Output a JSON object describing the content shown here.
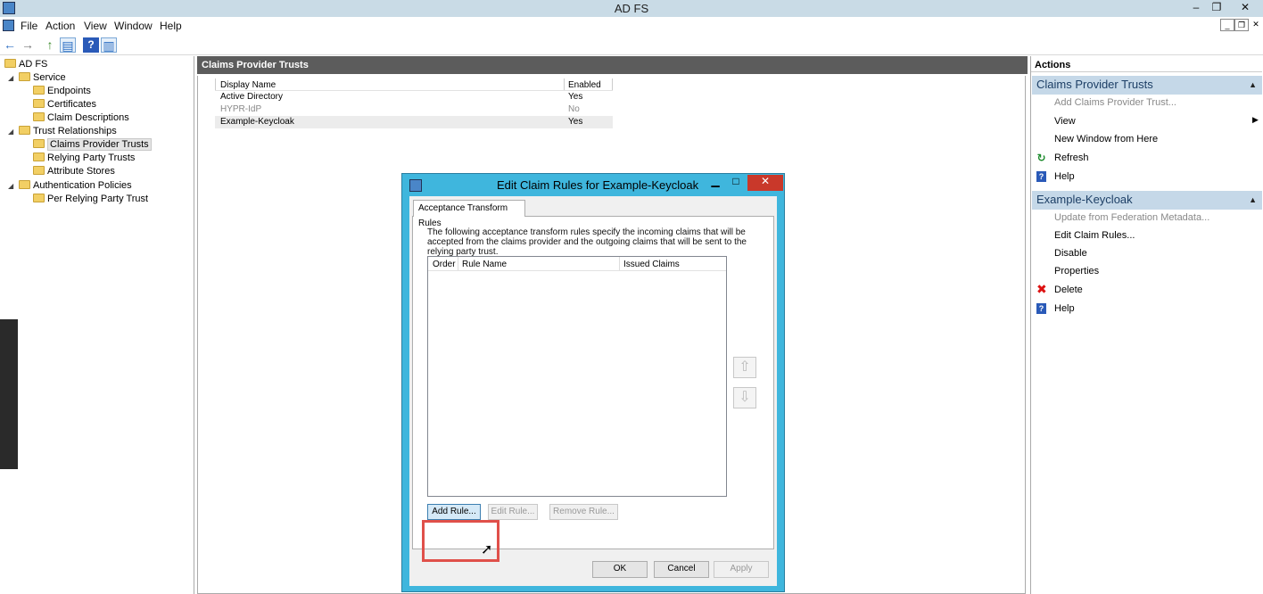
{
  "window": {
    "title": "AD FS",
    "min": "–",
    "restore": "❐",
    "close": "✕"
  },
  "menu": {
    "items": [
      "File",
      "Action",
      "View",
      "Window",
      "Help"
    ]
  },
  "mdi": {
    "min": "_",
    "restore": "❐",
    "close": "✕"
  },
  "toolbar": {
    "back": "←",
    "forward": "→",
    "up": "↑",
    "showhide": "▤",
    "help": "?",
    "panel": "▥"
  },
  "tree": {
    "root": "AD FS",
    "service": "Service",
    "endpoints": "Endpoints",
    "certificates": "Certificates",
    "claim_descriptions": "Claim Descriptions",
    "trust_relationships": "Trust Relationships",
    "claims_provider_trusts": "Claims Provider Trusts",
    "relying_party_trusts": "Relying Party Trusts",
    "attribute_stores": "Attribute Stores",
    "authentication_policies": "Authentication Policies",
    "per_relying_party_trust": "Per Relying Party Trust"
  },
  "center": {
    "header": "Claims Provider Trusts",
    "columns": {
      "display_name": "Display Name",
      "enabled": "Enabled"
    },
    "rows": [
      {
        "name": "Active Directory",
        "enabled": "Yes"
      },
      {
        "name": "HYPR-IdP",
        "enabled": "No"
      },
      {
        "name": "Example-Keycloak",
        "enabled": "Yes"
      }
    ]
  },
  "actions": {
    "header": "Actions",
    "section1": {
      "title": "Claims Provider Trusts",
      "add": "Add Claims Provider Trust...",
      "view": "View",
      "new_window": "New Window from Here",
      "refresh": "Refresh",
      "help": "Help"
    },
    "section2": {
      "title": "Example-Keycloak",
      "update": "Update from Federation Metadata...",
      "edit_claim_rules": "Edit Claim Rules...",
      "disable": "Disable",
      "properties": "Properties",
      "delete": "Delete",
      "help": "Help"
    }
  },
  "dialog": {
    "title": "Edit Claim Rules for Example-Keycloak",
    "tab": "Acceptance Transform Rules",
    "description": "The following acceptance transform rules specify the incoming claims that will be accepted from the claims provider and the outgoing claims that will be sent to the relying party trust.",
    "columns": {
      "order": "Order",
      "rule_name": "Rule Name",
      "issued_claims": "Issued Claims"
    },
    "buttons": {
      "add_rule": "Add Rule...",
      "edit_rule": "Edit Rule...",
      "remove_rule": "Remove Rule...",
      "ok": "OK",
      "cancel": "Cancel",
      "apply": "Apply",
      "move_up": "⇧",
      "move_down": "⇩"
    }
  },
  "colors": {
    "title_bar": "#c9dbe6",
    "dialog_frame": "#3fb6dd",
    "action_section": "#c5d8e8",
    "highlight": "#e0504a"
  }
}
